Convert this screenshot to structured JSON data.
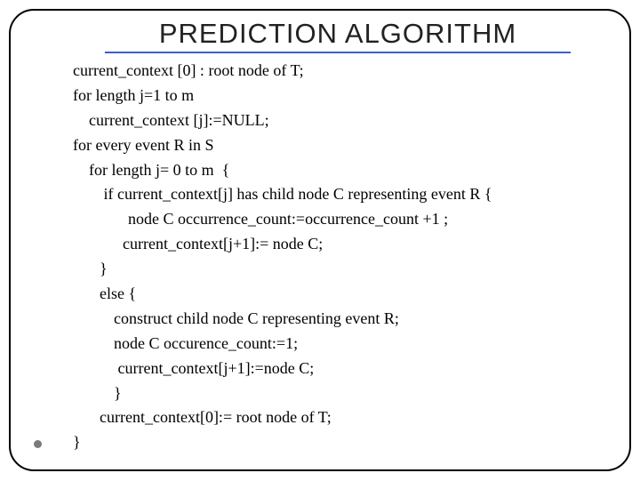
{
  "title": "PREDICTION ALGORITHM",
  "lines": [
    {
      "cls": "",
      "text": "current_context [0] : root node of T;"
    },
    {
      "cls": "",
      "text": "for length j=1 to m"
    },
    {
      "cls": "i1",
      "text": "current_context [j]:=NULL;"
    },
    {
      "cls": "",
      "text": "for every event R in S"
    },
    {
      "cls": "i1",
      "text": "for length j= 0 to m  {"
    },
    {
      "cls": "i2",
      "text": " if current_context[j] has child node C representing event R {"
    },
    {
      "cls": "i4",
      "text": "node C occurrence_count:=occurrence_count +1 ;"
    },
    {
      "cls": "i5",
      "text": "current_context[j+1]:= node C;"
    },
    {
      "cls": "i2",
      "text": "}"
    },
    {
      "cls": "i2",
      "text": "else {"
    },
    {
      "cls": "i3",
      "text": "construct child node C representing event R;"
    },
    {
      "cls": "i3",
      "text": "node C occurence_count:=1;"
    },
    {
      "cls": "i3",
      "text": " current_context[j+1]:=node C;"
    },
    {
      "cls": "i3",
      "text": "}"
    },
    {
      "cls": "i2",
      "text": "current_context[0]:= root node of T;"
    },
    {
      "cls": "",
      "text": "}"
    }
  ]
}
